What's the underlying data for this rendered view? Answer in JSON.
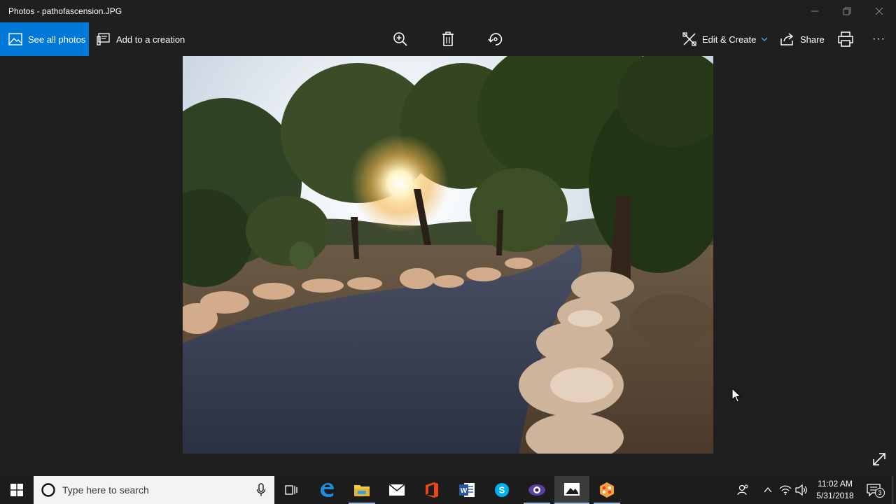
{
  "window": {
    "title": "Photos - pathofascension.JPG"
  },
  "toolbar": {
    "see_all_label": "See all photos",
    "add_creation_label": "Add to a creation",
    "edit_create_label": "Edit & Create",
    "share_label": "Share",
    "more_label": "···"
  },
  "taskbar": {
    "search_placeholder": "Type here to search",
    "time": "11:02 AM",
    "date": "5/31/2018",
    "notification_count": "3",
    "apps": [
      "task-view",
      "edge",
      "file-explorer",
      "mail",
      "office",
      "word",
      "skype",
      "cyberlink",
      "photos",
      "paint"
    ]
  },
  "colors": {
    "accent": "#0078d7",
    "background": "#1f1f1f",
    "taskbar": "#1c1c1c"
  }
}
